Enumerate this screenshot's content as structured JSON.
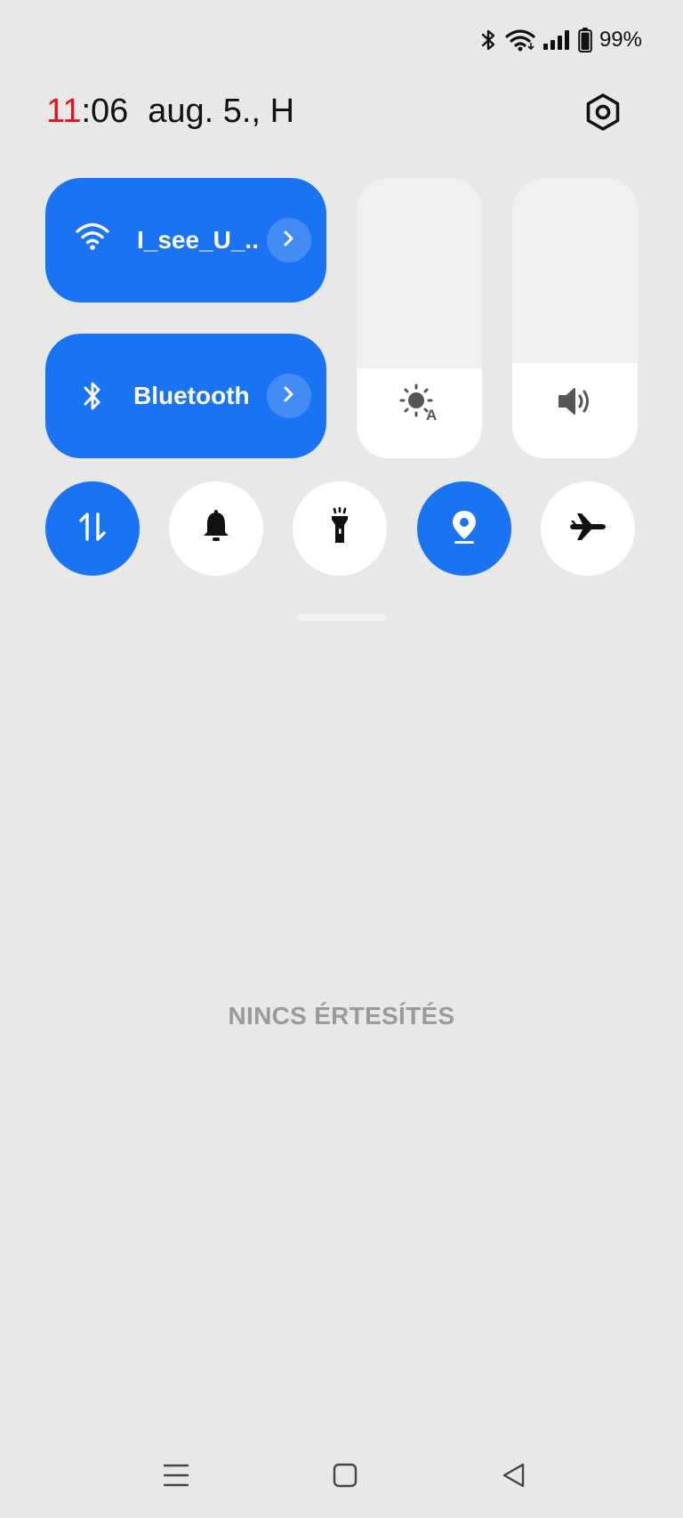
{
  "status_bar": {
    "icons": [
      "bluetooth-icon",
      "wifi-icon",
      "signal-icon",
      "battery-icon"
    ],
    "battery_percent": "99%"
  },
  "header": {
    "clock_hours": "11",
    "clock_minutes": ":06",
    "date": "aug. 5., H",
    "settings_icon": "settings-hexagon-icon"
  },
  "tiles": {
    "wifi": {
      "label": "I_see_U_..",
      "icon": "wifi-icon",
      "active": true
    },
    "bluetooth": {
      "label": "Bluetooth",
      "icon": "bluetooth-icon",
      "active": true
    }
  },
  "sliders": {
    "brightness": {
      "icon": "auto-brightness-icon",
      "level_fraction": 0.32
    },
    "volume": {
      "icon": "volume-icon",
      "level_fraction": 0.34
    }
  },
  "quick_toggles": [
    {
      "name": "mobile-data",
      "icon": "data-arrows-icon",
      "active": true
    },
    {
      "name": "sound",
      "icon": "bell-icon",
      "active": false
    },
    {
      "name": "flashlight",
      "icon": "flashlight-icon",
      "active": false
    },
    {
      "name": "location",
      "icon": "location-pin-icon",
      "active": true
    },
    {
      "name": "airplane-mode",
      "icon": "airplane-icon",
      "active": false
    }
  ],
  "notifications": {
    "empty_text": "NINCS ÉRTESÍTÉS"
  },
  "nav_bar": {
    "buttons": [
      "menu-icon",
      "home-icon",
      "back-icon"
    ]
  },
  "colors": {
    "accent": "#1a73f2",
    "background": "#e8e8e8",
    "clock_hours": "#e0121f",
    "muted_text": "#9a9a9a"
  }
}
